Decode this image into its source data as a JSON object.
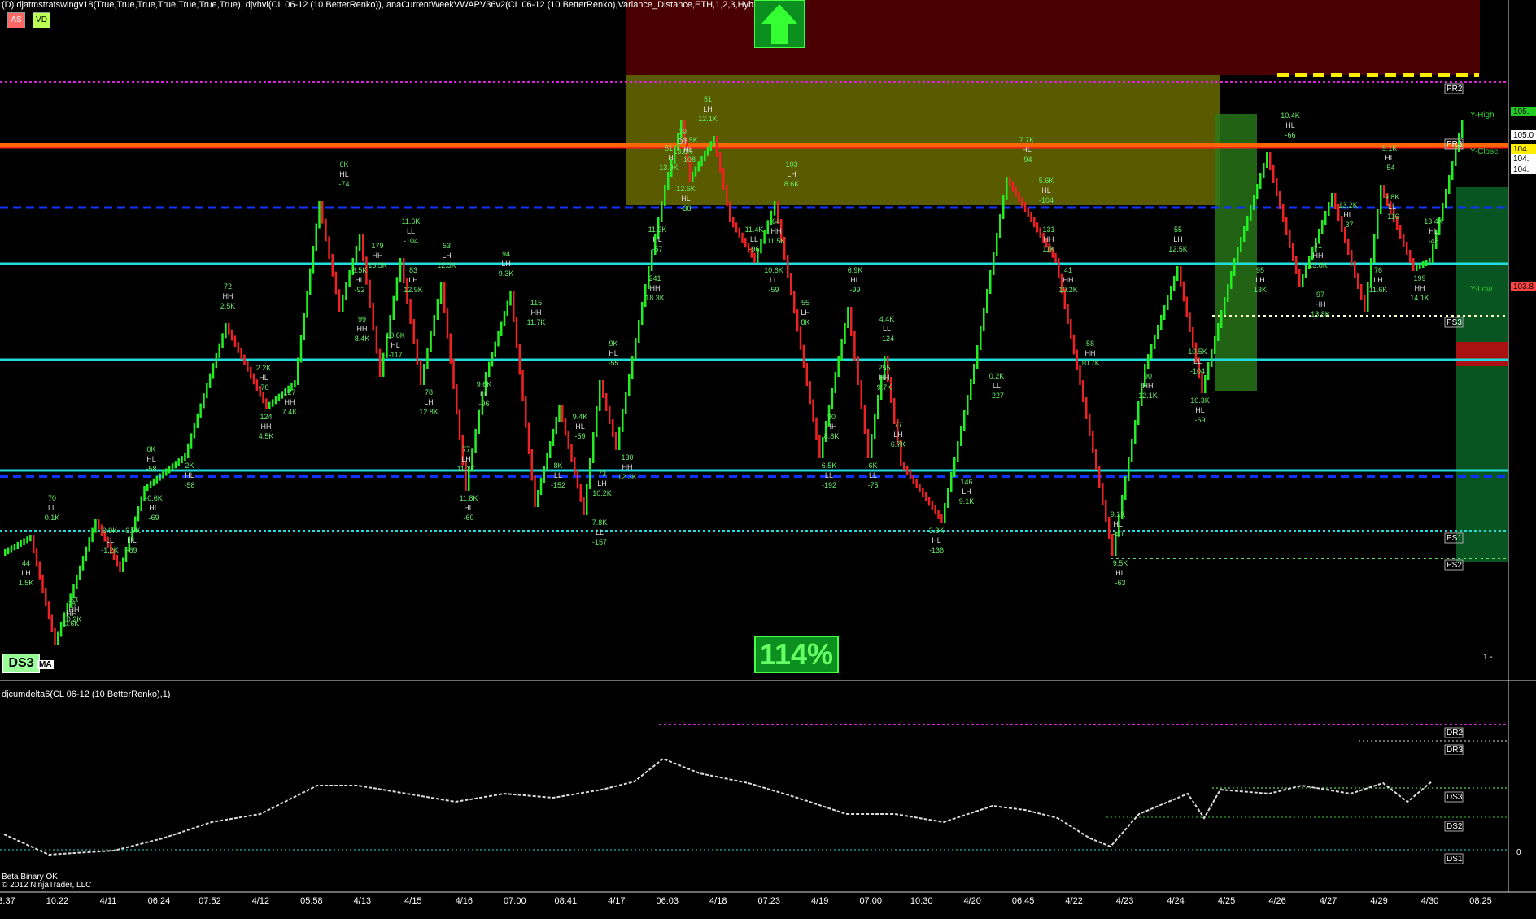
{
  "header": {
    "title": "(D) djatmstratswingv18(True,True,True,True,True,True,True), djvhvl(CL 06-12 (10 BetterRenko)), anaCurrentWeekVWAPV36v2(CL 06-12 (10 BetterRenko),Variance_Distance,ETH,1,2,3,Hybrid)",
    "badges": [
      "AS",
      "VD"
    ]
  },
  "sub_panel": {
    "title": "djcumdelta6(CL 06-12 (10 BetterRenko),1)"
  },
  "footer": {
    "status": "Beta Binary OK",
    "copyright": "© 2012 NinjaTrader, LLC"
  },
  "overlay": {
    "ds3": "DS3",
    "ma": "MA",
    "percent": "114%",
    "arrow": "up-arrow-icon",
    "minus": "1 -"
  },
  "colors": {
    "up": "#22ee22",
    "down": "#ee2222",
    "resistance_zone": "#4a0000",
    "olive_zone": "#5a5a00",
    "cyan": "#22dddd",
    "blue": "#1133ff",
    "magenta": "#dd22dd",
    "orange": "#ff6600"
  },
  "chart_data": {
    "type": "line",
    "instrument": "CL 06-12 (10 BetterRenko)",
    "x_labels": [
      "3:37",
      "10:22",
      "4/11",
      "06:24",
      "07:52",
      "4/12",
      "05:58",
      "4/13",
      "4/15",
      "4/16",
      "07:00",
      "08:41",
      "4/17",
      "06:03",
      "4/18",
      "07:23",
      "4/19",
      "07:00",
      "10:30",
      "4/20",
      "06:45",
      "4/22",
      "4/23",
      "4/24",
      "4/25",
      "4/26",
      "4/27",
      "4/29",
      "4/30",
      "08:25"
    ],
    "price_labels": [
      "105.",
      "105.0",
      "104.",
      "104.",
      "104.",
      "103.8"
    ],
    "level_labels": [
      "PR2",
      "PR3",
      "PS3",
      "PS1",
      "PS2",
      "Y-High",
      "Y-Close",
      "Y-Low"
    ],
    "sub_level_labels": [
      "DR2",
      "DR3",
      "DS3",
      "DS2",
      "DS1",
      "0"
    ],
    "swing_annotations": [
      [
        "84",
        "LH",
        "2K"
      ],
      [
        "44",
        "LH",
        "1.5K"
      ],
      [
        "70",
        "LL",
        "0.1K"
      ],
      [
        "63",
        "HH",
        "0.2K"
      ],
      [
        "78",
        "HH",
        "0.6K"
      ],
      [
        "0.9K",
        "LL",
        "-1.2K"
      ],
      [
        "-0.9K",
        "HL",
        "-69"
      ],
      [
        "-0.6K",
        "HL",
        "-69"
      ],
      [
        "0K",
        "HL",
        "-58"
      ],
      [
        "2K",
        "HL",
        "-58"
      ],
      [
        "72",
        "HH",
        "2.5K"
      ],
      [
        "124",
        "HH",
        "4.5K"
      ],
      [
        "2.2K",
        "HL",
        "-70"
      ],
      [
        "127",
        "HH",
        "7.4K"
      ],
      [
        "6K",
        "HL",
        "-74"
      ],
      [
        "99",
        "HH",
        "8.4K"
      ],
      [
        "6.5K",
        "HL",
        "-92"
      ],
      [
        "179",
        "HH",
        "13.5K"
      ],
      [
        "10.6K",
        "HL",
        "-117"
      ],
      [
        "83",
        "LH",
        "12.9K"
      ],
      [
        "11.6K",
        "LL",
        "-104"
      ],
      [
        "78",
        "LH",
        "12.8K"
      ],
      [
        "53",
        "LH",
        "12.5K"
      ],
      [
        "11.8K",
        "HL",
        "-60"
      ],
      [
        "77",
        "LH",
        "11.2K"
      ],
      [
        "9.6K",
        "LL",
        "-96"
      ],
      [
        "94",
        "LH",
        "9.3K"
      ],
      [
        "115",
        "HH",
        "11.7K"
      ],
      [
        "8K",
        "LL",
        "-152"
      ],
      [
        "9.4K",
        "HL",
        "-59"
      ],
      [
        "73",
        "LH",
        "10.2K"
      ],
      [
        "7.8K",
        "LL",
        "-157"
      ],
      [
        "9K",
        "HL",
        "-55"
      ],
      [
        "130",
        "HH",
        "12.3K"
      ],
      [
        "11.2K",
        "HL",
        "-57"
      ],
      [
        "241",
        "HH",
        "18.3K"
      ],
      [
        "51",
        "LH",
        "13.9K"
      ],
      [
        "39",
        "DT",
        "13.8K"
      ],
      [
        "13.5K",
        "HL",
        "-108"
      ],
      [
        "12.6K",
        "HL",
        "-38"
      ],
      [
        "51",
        "LH",
        "12.1K"
      ],
      [
        "11.4K",
        "LL",
        "-96"
      ],
      [
        "64",
        "HH",
        "11.5K"
      ],
      [
        "10.6K",
        "LL",
        "-59"
      ],
      [
        "103",
        "LH",
        "8.6K"
      ],
      [
        "55",
        "LH",
        "8K"
      ],
      [
        "90",
        "HH",
        "8.8K"
      ],
      [
        "6.5K",
        "LL",
        "-192"
      ],
      [
        "6.9K",
        "HL",
        "-99"
      ],
      [
        "6K",
        "LL",
        "-75"
      ],
      [
        "4.4K",
        "LL",
        "-124"
      ],
      [
        "255",
        "HH",
        "9.7K"
      ],
      [
        "77",
        "LH",
        "6.7K"
      ],
      [
        "3.8K",
        "HL",
        "-136"
      ],
      [
        "146",
        "LH",
        "9.1K"
      ],
      [
        "0.2K",
        "LL",
        "-227"
      ],
      [
        "7.7K",
        "HL",
        "-94"
      ],
      [
        "131",
        "HH",
        "11K"
      ],
      [
        "5.6K",
        "HL",
        "-104"
      ],
      [
        "41",
        "HH",
        "10.2K"
      ],
      [
        "58",
        "HH",
        "10.7K"
      ],
      [
        "9.5K",
        "HL",
        "-63"
      ],
      [
        "9.1K",
        "HL",
        "-40"
      ],
      [
        "90",
        "HH",
        "12.1K"
      ],
      [
        "55",
        "LH",
        "12.5K"
      ],
      [
        "10.3K",
        "HL",
        "-69"
      ],
      [
        "10.5K",
        "LL",
        "-104"
      ],
      [
        "95",
        "LH",
        "13K"
      ],
      [
        "10.4K",
        "HL",
        "-66"
      ],
      [
        "97",
        "HH",
        "13.8K"
      ],
      [
        "41",
        "HH",
        "13.8K"
      ],
      [
        "13.2K",
        "HL",
        "-37"
      ],
      [
        "76",
        "LH",
        "11.6K"
      ],
      [
        "9.8K",
        "LL",
        "-116"
      ],
      [
        "9.1K",
        "HL",
        "-54"
      ],
      [
        "199",
        "HH",
        "14.1K"
      ],
      [
        "13.4K",
        "HL",
        "-46"
      ]
    ],
    "grid": false,
    "legend": "none"
  }
}
